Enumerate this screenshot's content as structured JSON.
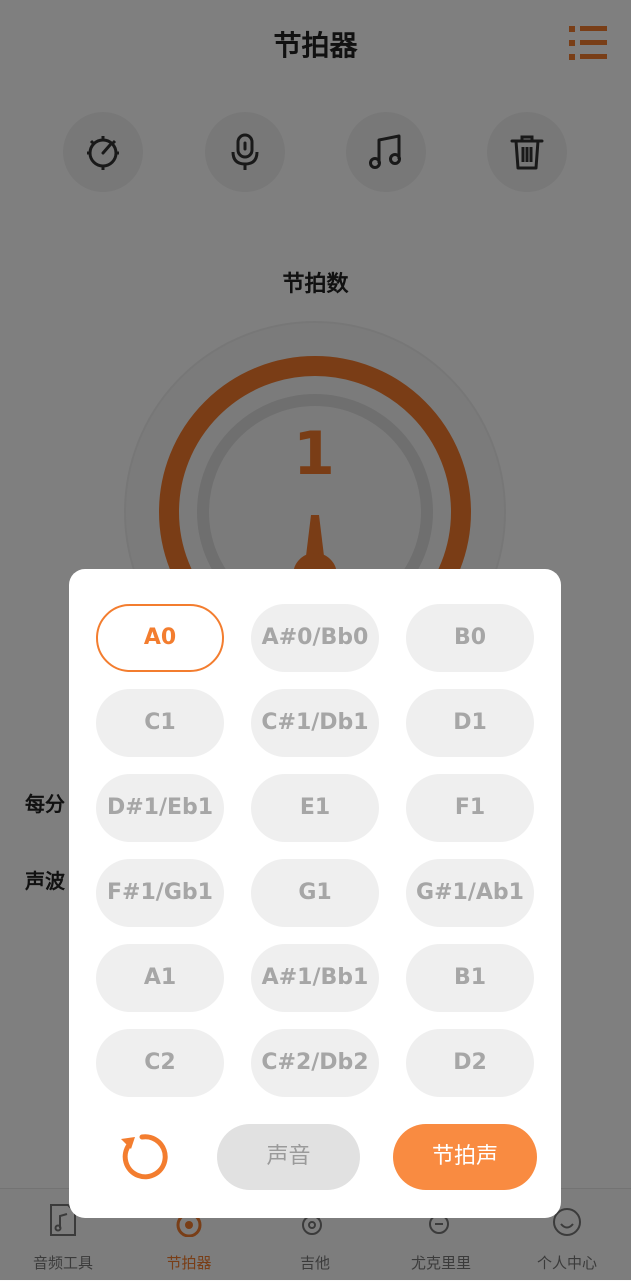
{
  "header": {
    "title": "节拍器",
    "menu_icon": "list-menu-icon",
    "accent": "#f37d2f"
  },
  "tools": [
    {
      "name": "tuner-icon"
    },
    {
      "name": "microphone-icon"
    },
    {
      "name": "music-note-icon"
    },
    {
      "name": "trash-icon"
    }
  ],
  "metronome": {
    "section_label": "节拍数",
    "beat_count": "1"
  },
  "side_labels": {
    "bpm": "每分",
    "wave": "声波"
  },
  "note_picker": {
    "notes": [
      "A0",
      "A#0/Bb0",
      "B0",
      "C1",
      "C#1/Db1",
      "D1",
      "D#1/Eb1",
      "E1",
      "F1",
      "F#1/Gb1",
      "G1",
      "G#1/Ab1",
      "A1",
      "A#1/Bb1",
      "B1",
      "C2",
      "C#2/Db2",
      "D2"
    ],
    "selected": "A0",
    "reset_icon": "reset-icon",
    "sound_label": "声音",
    "beat_sound_label": "节拍声"
  },
  "tabbar": {
    "tabs": [
      {
        "label": "音频工具",
        "icon": "audio-file-icon"
      },
      {
        "label": "节拍器",
        "icon": "metronome-icon",
        "active": true
      },
      {
        "label": "吉他",
        "icon": "guitar-icon"
      },
      {
        "label": "尤克里里",
        "icon": "ukulele-icon"
      },
      {
        "label": "个人中心",
        "icon": "smile-face-icon"
      }
    ]
  }
}
